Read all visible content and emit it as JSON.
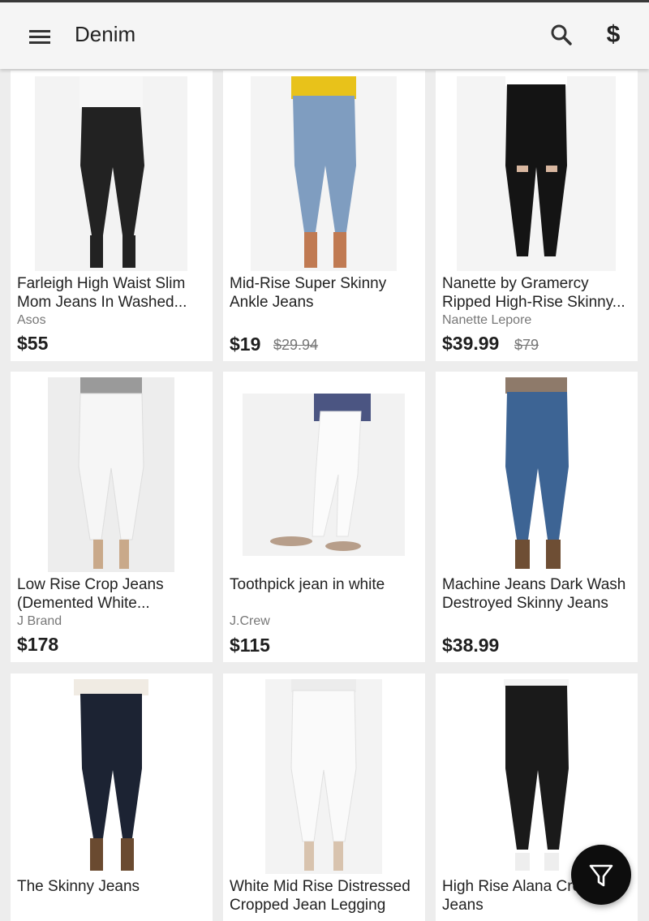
{
  "app_bar": {
    "title": "Denim",
    "dollar_glyph": "$",
    "menu_icon": "hamburger-menu-icon",
    "search_icon": "search-icon",
    "price_icon": "dollar-icon"
  },
  "products": [
    {
      "name": "Farleigh High Waist Slim Mom Jeans In Washed...",
      "brand": "Asos",
      "price": "$55",
      "original_price": "",
      "jeans_color": "#222222"
    },
    {
      "name": "Mid-Rise Super Skinny Ankle Jeans",
      "brand": "",
      "price": "$19",
      "original_price": "$29.94",
      "jeans_color": "#7f9dc0"
    },
    {
      "name": "Nanette by Gramercy Ripped High-Rise Skinny...",
      "brand": "Nanette Lepore",
      "price": "$39.99",
      "original_price": "$79",
      "jeans_color": "#141414"
    },
    {
      "name": "Low Rise Crop Jeans (Demented White...",
      "brand": "J Brand",
      "price": "$178",
      "original_price": "",
      "jeans_color": "#f6f6f6"
    },
    {
      "name": "Toothpick jean in white",
      "brand": "J.Crew",
      "price": "$115",
      "original_price": "",
      "jeans_color": "#fbfbfb"
    },
    {
      "name": "Machine Jeans Dark Wash Destroyed Skinny Jeans",
      "brand": "",
      "price": "$38.99",
      "original_price": "",
      "jeans_color": "#3d6494"
    },
    {
      "name": "The Skinny Jeans",
      "brand": "",
      "price": "",
      "original_price": "",
      "jeans_color": "#1c2333"
    },
    {
      "name": "White Mid Rise Distressed Cropped Jean Legging",
      "brand": "",
      "price": "",
      "original_price": "",
      "jeans_color": "#fafafa"
    },
    {
      "name": "High Rise Alana Cropped Jeans",
      "brand": "",
      "price": "",
      "original_price": "",
      "jeans_color": "#1a1a1a"
    }
  ],
  "fab": {
    "icon": "filter-icon"
  }
}
